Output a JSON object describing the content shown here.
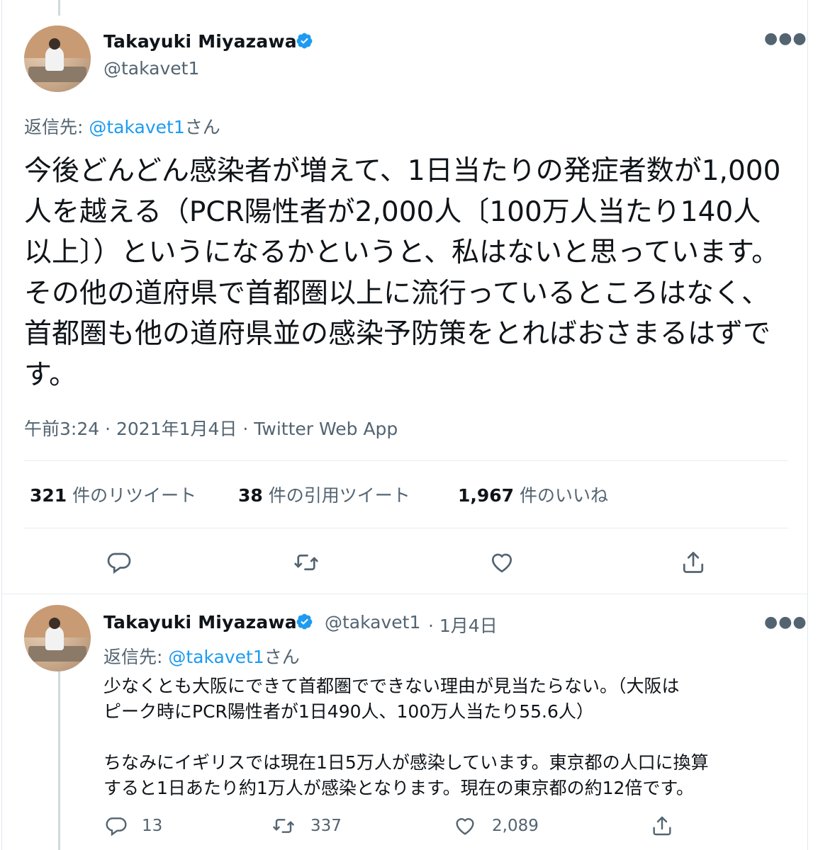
{
  "main_tweet": {
    "author_name": "Takayuki Miyazawa",
    "author_handle": "@takavet1",
    "reply_prefix": "返信先: ",
    "reply_handle": "@takavet1",
    "reply_suffix": "さん",
    "text": "今後どんどん感染者が増えて、1日当たりの発症者数が1,000人を越える（PCR陽性者が2,000人〔100万人当たり140人以上〕）というになるかというと、私はないと思っています。その他の道府県で首都圏以上に流行っているところはなく、首都圏も他の道府県並の感染予防策をとればおさまるはずです。",
    "timestamp": "午前3:24 · 2021年1月4日 · Twitter Web App",
    "stats": {
      "retweets_count": "321",
      "retweets_label": "件のリツイート",
      "quotes_count": "38",
      "quotes_label": "件の引用ツイート",
      "likes_count": "1,967",
      "likes_label": "件のいいね"
    }
  },
  "reply_tweet": {
    "author_name": "Takayuki Miyazawa",
    "author_handle": "@takavet1",
    "date": "· 1月4日",
    "reply_prefix": "返信先: ",
    "reply_handle": "@takavet1",
    "reply_suffix": "さん",
    "text": "少なくとも大阪にできて首都圏でできない理由が見当たらない。（大阪は\nピーク時にPCR陽性者が1日490人、100万人当たり55.6人）\n\nちなみにイギリスでは現在1日5万人が感染しています。東京都の人口に換算\nすると1日あたり約1万人が感染となります。現在の東京都の約12倍です。",
    "counts": {
      "replies": "13",
      "retweets": "337",
      "likes": "2,089"
    }
  },
  "icons": [
    "avatar",
    "verified-badge-icon",
    "more-icon",
    "reply-icon",
    "retweet-icon",
    "like-icon",
    "share-icon"
  ],
  "colors": {
    "link": "#1d9bf0",
    "verified": "#1d9bf0",
    "secondary": "#536471",
    "primary": "#0f1419"
  }
}
